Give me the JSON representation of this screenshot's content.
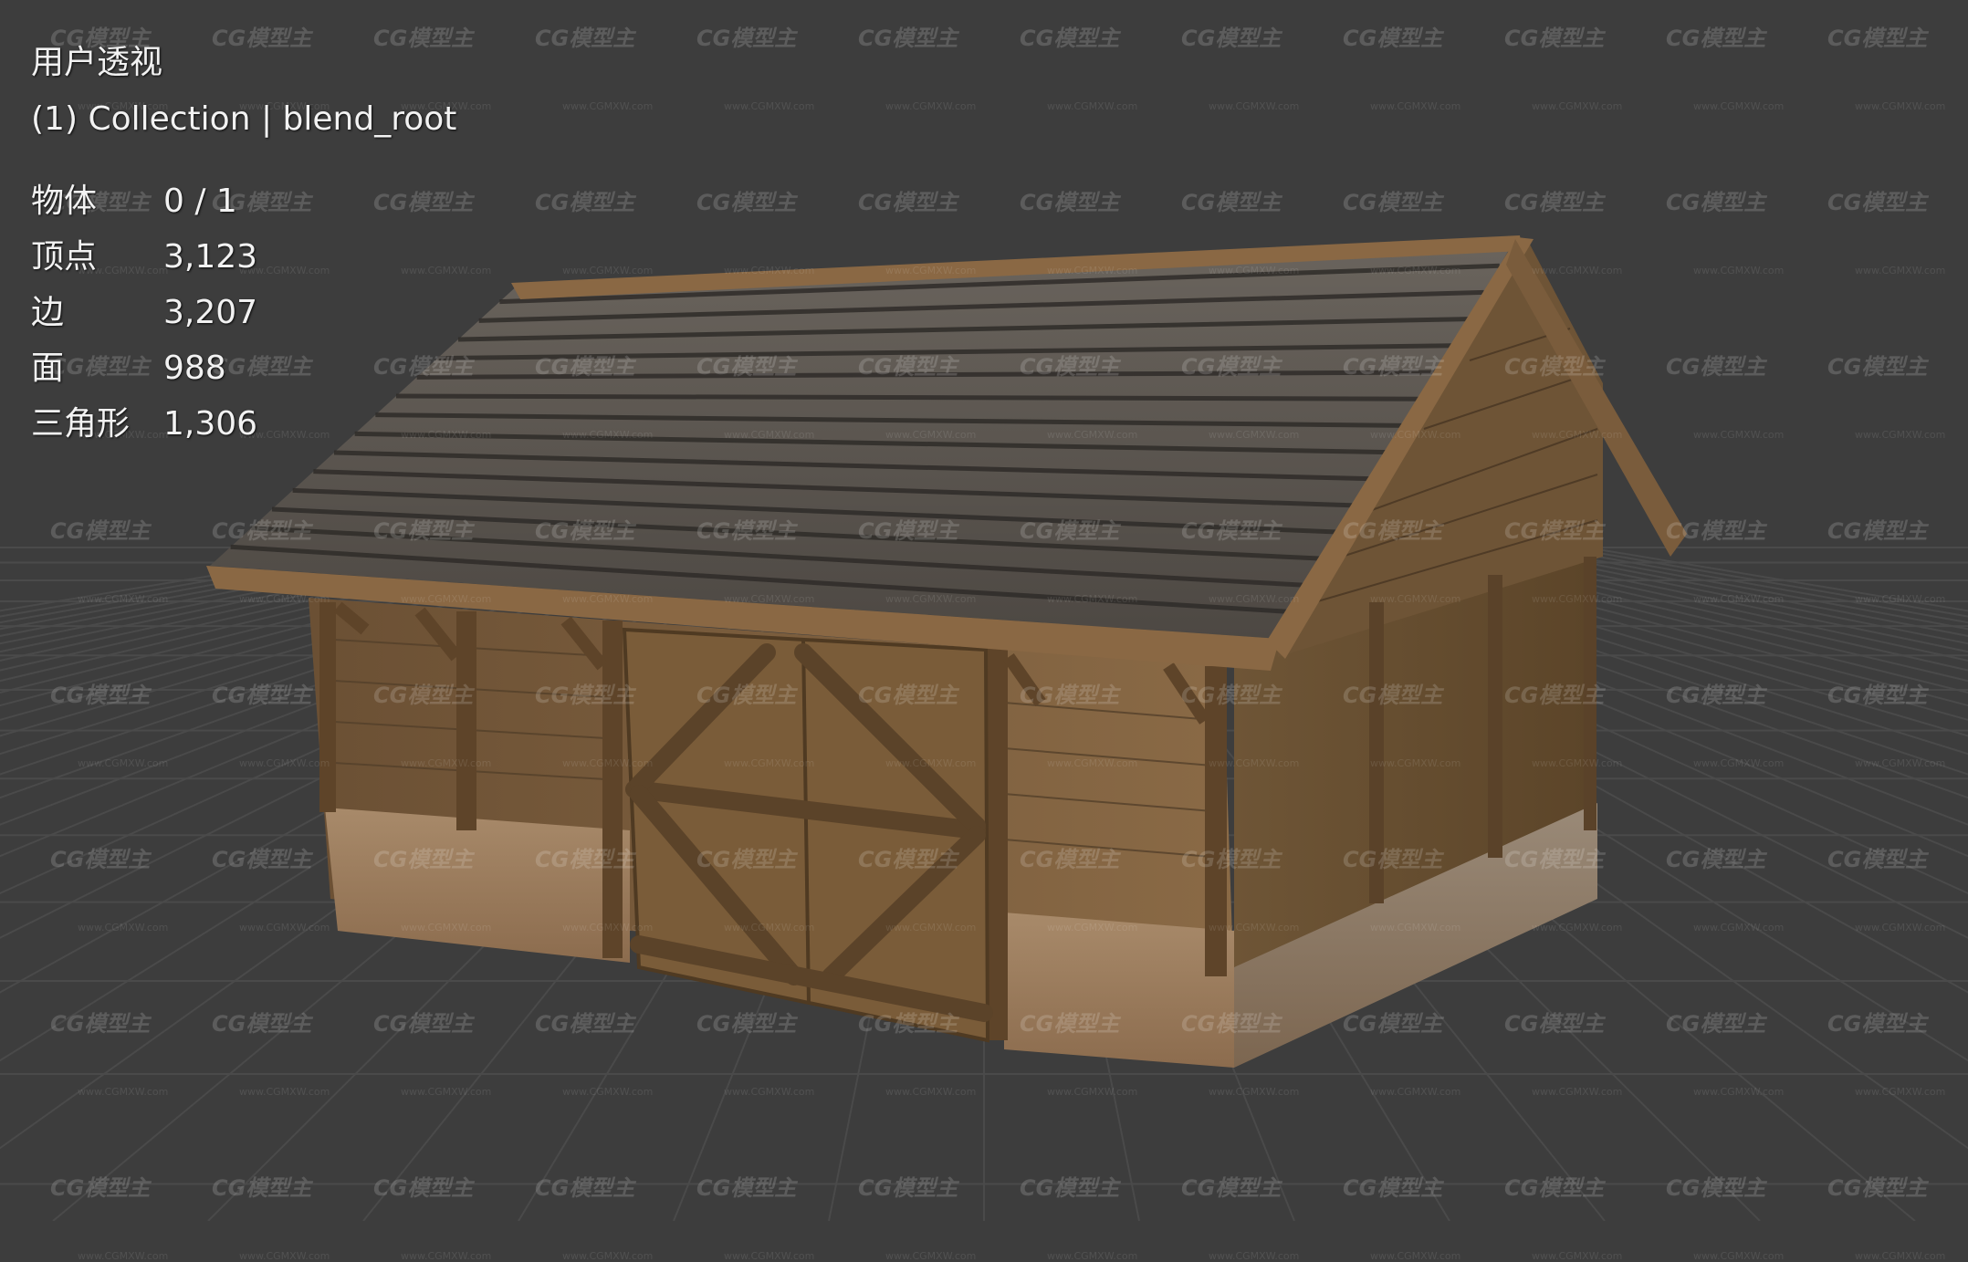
{
  "viewport": {
    "view_name": "用户透视",
    "collection_line": "(1) Collection | blend_root",
    "background_color": "#3d3d3d",
    "grid_color": "#4a4a4a"
  },
  "stats": [
    {
      "label": "物体",
      "value": "0 / 1"
    },
    {
      "label": "顶点",
      "value": "3,123"
    },
    {
      "label": "边",
      "value": "3,207"
    },
    {
      "label": "面",
      "value": "988"
    },
    {
      "label": "三角形",
      "value": "1,306"
    }
  ],
  "watermark": {
    "brand": "CG模型主",
    "url": "www.CGMXW.com"
  },
  "model": {
    "name": "wooden-barn",
    "roof_color": "#5b5650",
    "wood_color": "#7a5a38",
    "stone_color": "#9a7a5c"
  }
}
